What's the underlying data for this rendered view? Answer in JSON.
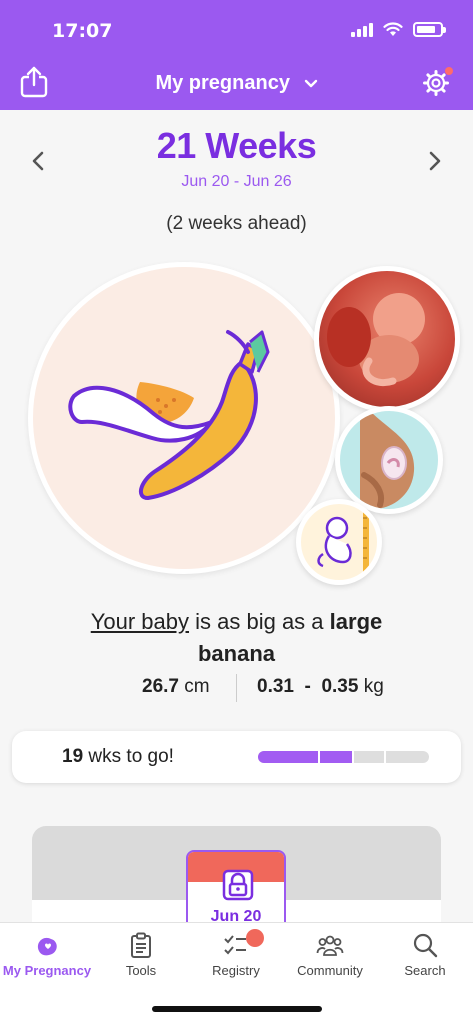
{
  "status_bar": {
    "time": "17:07"
  },
  "nav": {
    "title": "My pregnancy",
    "share_icon": "share-icon",
    "settings_icon": "gear-icon",
    "settings_badge_color": "#ff6b6b"
  },
  "week": {
    "title": "21 Weeks",
    "range": "Jun 20 - Jun 26",
    "ahead": "(2 weeks ahead)"
  },
  "baby_size": {
    "prefix_link": "Your baby",
    "middle": " is as big as a ",
    "fruit_line1": "large",
    "fruit_line2": "banana",
    "length_value": "26.7",
    "length_unit": " cm",
    "weight_min": "0.31",
    "weight_sep": "  -  ",
    "weight_max": "0.35",
    "weight_unit": " kg",
    "illustration": "banana-icon"
  },
  "thumbnails": [
    {
      "name": "fetus-3d-image"
    },
    {
      "name": "pregnant-belly-image"
    },
    {
      "name": "baby-size-ruler-image"
    }
  ],
  "progress": {
    "weeks_left": "19",
    "text": " wks to go!",
    "fraction_complete": 0.55
  },
  "content_card": {
    "date": "Jun 20",
    "icon": "lock-icon"
  },
  "tabs": [
    {
      "label": "My Pregnancy",
      "icon": "pregnancy-icon",
      "active": true
    },
    {
      "label": "Tools",
      "icon": "clipboard-icon",
      "active": false
    },
    {
      "label": "Registry",
      "icon": "checklist-icon",
      "active": false
    },
    {
      "label": "Community",
      "icon": "people-icon",
      "active": false
    },
    {
      "label": "Search",
      "icon": "search-icon",
      "active": false
    }
  ],
  "colors": {
    "brand": "#9b59f0",
    "title_purple": "#7a2ee0",
    "accent_red": "#f0685b"
  }
}
